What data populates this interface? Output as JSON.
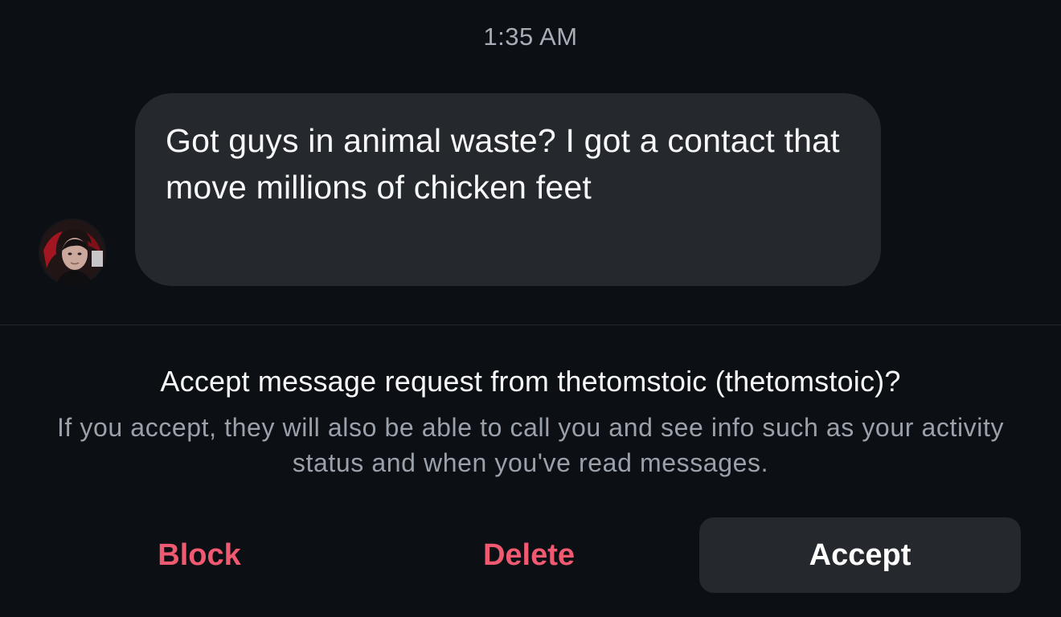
{
  "thread": {
    "timestamp": "1:35 AM",
    "message_text": "Got guys in animal waste? I got a contact that move millions of chicken feet",
    "sender_avatar_icon": "profile-photo"
  },
  "request": {
    "title": "Accept message request from thetomstoic (thetomstoic)?",
    "subtitle": "If you accept, they will also be able to call you and see info such as your activity status and when you've read messages."
  },
  "actions": {
    "block_label": "Block",
    "delete_label": "Delete",
    "accept_label": "Accept"
  },
  "colors": {
    "background": "#0c0f14",
    "bubble": "#25282d",
    "destructive": "#f05a71",
    "secondary_text": "#9aa1ab"
  }
}
